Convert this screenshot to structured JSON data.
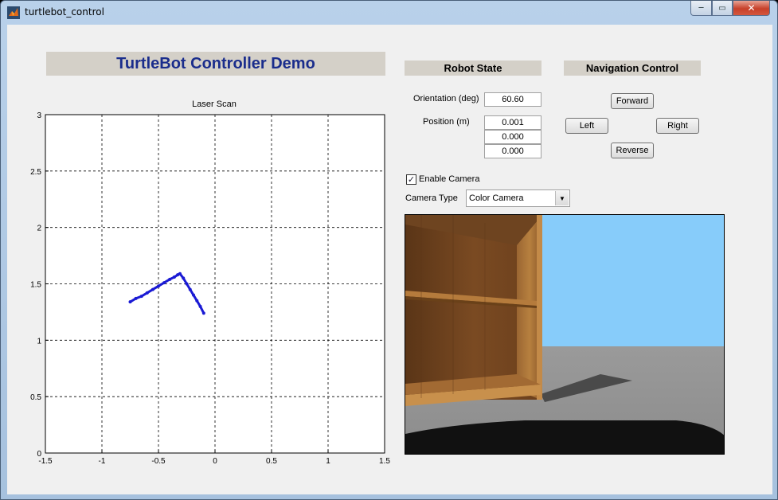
{
  "window": {
    "title": "turtlebot_control",
    "minimize_glyph": "─",
    "maximize_glyph": "▭",
    "close_glyph": "✕"
  },
  "header": {
    "title": "TurtleBot Controller Demo"
  },
  "robot_state": {
    "title": "Robot State",
    "orientation_label": "Orientation (deg)",
    "orientation_value": "60.60",
    "position_label": "Position (m)",
    "position_values": [
      "0.001",
      "0.000",
      "0.000"
    ]
  },
  "navigation": {
    "title": "Navigation Control",
    "forward": "Forward",
    "left": "Left",
    "right": "Right",
    "reverse": "Reverse"
  },
  "camera": {
    "enable_label": "Enable Camera",
    "enabled": true,
    "check_glyph": "✓",
    "type_label": "Camera Type",
    "type_value": "Color Camera",
    "dropdown_glyph": "▼"
  },
  "colors": {
    "title_text": "#1a2d8c",
    "scan_points": "#1a1ad4",
    "sky": "#87ccfa",
    "floor": "#999999",
    "wood": "#8a5a2b"
  },
  "icons": {
    "app": "matlab-icon",
    "dropdown": "chevron-down-icon"
  },
  "chart_data": {
    "type": "scatter",
    "title": "Laser Scan",
    "xlabel": "",
    "ylabel": "",
    "xlim": [
      -1.5,
      1.5
    ],
    "ylim": [
      0,
      3
    ],
    "grid": true,
    "xticks": [
      -1.5,
      -1,
      -0.5,
      0,
      0.5,
      1,
      1.5
    ],
    "xtick_labels": [
      "-1.5",
      "-1",
      "-0.5",
      "0",
      "0.5",
      "1",
      "1.5"
    ],
    "yticks": [
      0,
      0.5,
      1,
      1.5,
      2,
      2.5,
      3
    ],
    "ytick_labels": [
      "0",
      "0.5",
      "1",
      "1.5",
      "2",
      "2.5",
      "3"
    ],
    "series": [
      {
        "x": [
          -0.75,
          -0.7,
          -0.65,
          -0.6,
          -0.55,
          -0.5,
          -0.45,
          -0.4,
          -0.36,
          -0.33,
          -0.31,
          -0.28,
          -0.25,
          -0.22,
          -0.19,
          -0.16,
          -0.13,
          -0.1
        ],
        "y": [
          1.34,
          1.37,
          1.39,
          1.42,
          1.45,
          1.48,
          1.51,
          1.54,
          1.56,
          1.58,
          1.59,
          1.55,
          1.5,
          1.45,
          1.4,
          1.35,
          1.3,
          1.24
        ]
      }
    ]
  }
}
